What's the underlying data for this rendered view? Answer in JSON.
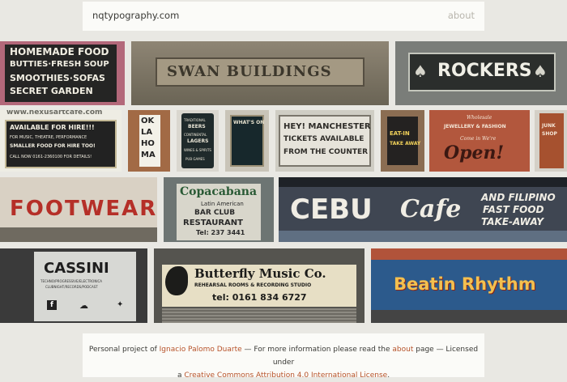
{
  "header": {
    "site_title": "nqtypography.com",
    "about_label": "about"
  },
  "tiles": {
    "homemade": {
      "l1": "HOMEMADE FOOD",
      "l2": "BUTTIES·FRESH SOUP",
      "l3": "SMOOTHIES·SOFAS",
      "l4": "SECRET GARDEN"
    },
    "swan": {
      "text": "SWAN BUILDINGS"
    },
    "rockers": {
      "text": "ROCKERS"
    },
    "nexus": {
      "url": "www.nexusartcafe.com",
      "l1": "AVAILABLE FOR HIRE!!!",
      "l2": "FOR MUSIC, THEATRE, PERFORMANCE",
      "l3": "SMALLER FOOD FOR HIRE TOO!",
      "l4": "CALL NOW 0161-2360100 FOR DETAILS!"
    },
    "oklahoma": {
      "l1": "OK",
      "l2": "LA",
      "l3": "HO",
      "l4": "MA"
    },
    "beers": {
      "l1": "TRADITIONAL",
      "l2": "BEERS",
      "l3": "CONTINENTAL",
      "l4": "LAGERS",
      "l5": "WINES & SPIRITS",
      "l6": "PUB GAMES"
    },
    "whatson": {
      "text": "WHAT'S ON"
    },
    "manchester": {
      "l1": "HEY! MANCHESTER",
      "l2": "TICKETS AVAILABLE",
      "l3": "FROM THE COUNTER"
    },
    "eatin": {
      "l1": "EAT-IN",
      "l2": "TAKE AWAY"
    },
    "open": {
      "small1": "Wholesale",
      "small2": "JEWELLERY & FASHION",
      "small3": "Come in We're",
      "big": "Open!"
    },
    "junk": {
      "l1": "JUNK",
      "l2": "SHOP"
    },
    "footwear": {
      "text": "FOOTWEAR"
    },
    "copacabana": {
      "l1": "Copacabana",
      "l2": "Latin American",
      "l3": "BAR   CLUB",
      "l4": "RESTAURANT",
      "l5": "Tel: 237 3441"
    },
    "cebu": {
      "word1": "CEBU",
      "word2": "Cafe",
      "r1": "AND FILIPINO",
      "r2": "FAST FOOD",
      "r3": "TAKE-AWAY"
    },
    "cassini": {
      "name": "CASSINI",
      "sub1": "TECHNO/PROGRESSIVE/ELECTRONICA",
      "sub2": "CLUBNIGHT/RECORDS/PODCAST"
    },
    "butterfly": {
      "title": "Butterfly Music Co.",
      "sub": "REHEARSAL ROOMS & RECORDING STUDIO",
      "tel": "tel: 0161 834 6727"
    },
    "beatin": {
      "text": "Beatin Rhythm"
    }
  },
  "footer": {
    "p1": "Personal project of ",
    "author": "Ignacio Palomo Duarte",
    "p2": " — For more information please read the ",
    "about": "about",
    "p3": " page — Licensed under",
    "p4": "a ",
    "license": "Creative Commons Attribution 4.0 International License",
    "p5": "."
  },
  "colors": {
    "background": "#e9e8e3",
    "link": "#b7532a",
    "bar": "#fbfbf8"
  }
}
